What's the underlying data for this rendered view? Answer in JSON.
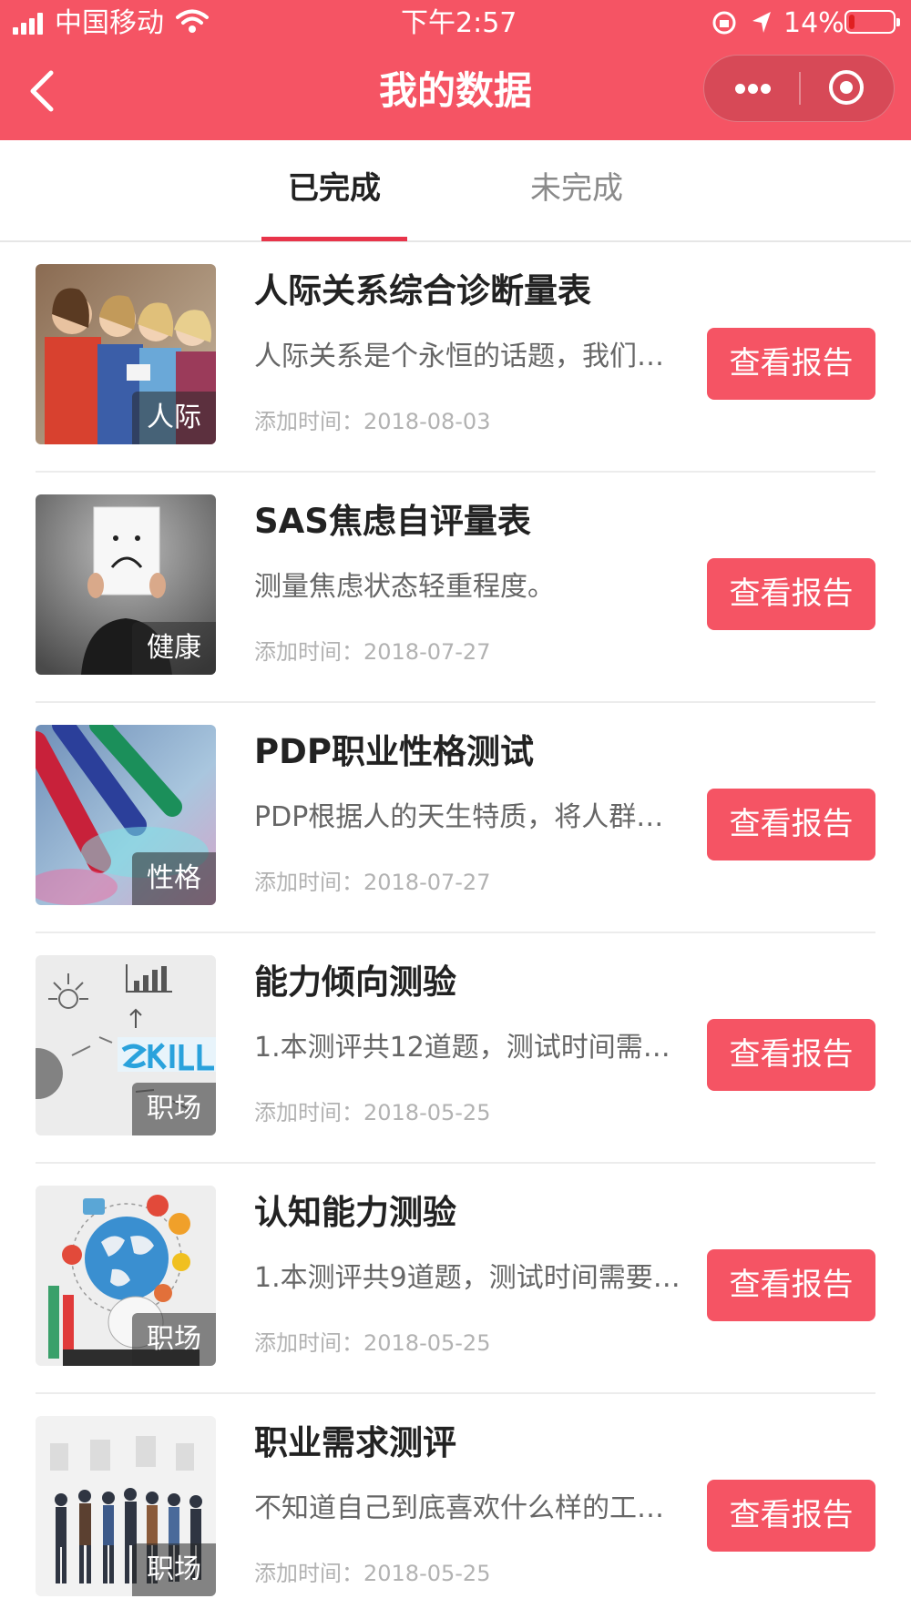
{
  "status_bar": {
    "carrier": "中国移动",
    "time": "下午2:57",
    "battery_percent": "14%",
    "battery_level": 0.14
  },
  "nav": {
    "title": "我的数据"
  },
  "tabs": [
    {
      "label": "已完成",
      "active": true
    },
    {
      "label": "未完成",
      "active": false
    }
  ],
  "colors": {
    "accent": "#f55464",
    "tab_indicator": "#e8344a"
  },
  "items": [
    {
      "title": "人际关系综合诊断量表",
      "desc": "人际关系是个永恒的话题，我们…",
      "time": "添加时间：2018-08-03",
      "tag": "人际",
      "button": "查看报告"
    },
    {
      "title": "SAS焦虑自评量表",
      "desc": "测量焦虑状态轻重程度。",
      "time": "添加时间：2018-07-27",
      "tag": "健康",
      "button": "查看报告"
    },
    {
      "title": "PDP职业性格测试",
      "desc": "PDP根据人的天生特质，将人群…",
      "time": "添加时间：2018-07-27",
      "tag": "性格",
      "button": "查看报告"
    },
    {
      "title": "能力倾向测验",
      "desc": "1.本测评共12道题，测试时间需…",
      "time": "添加时间：2018-05-25",
      "tag": "职场",
      "button": "查看报告"
    },
    {
      "title": "认知能力测验",
      "desc": "1.本测评共9道题，测试时间需要…",
      "time": "添加时间：2018-05-25",
      "tag": "职场",
      "button": "查看报告"
    },
    {
      "title": "职业需求测评",
      "desc": "不知道自己到底喜欢什么样的工…",
      "time": "添加时间：2018-05-25",
      "tag": "职场",
      "button": "查看报告"
    }
  ]
}
